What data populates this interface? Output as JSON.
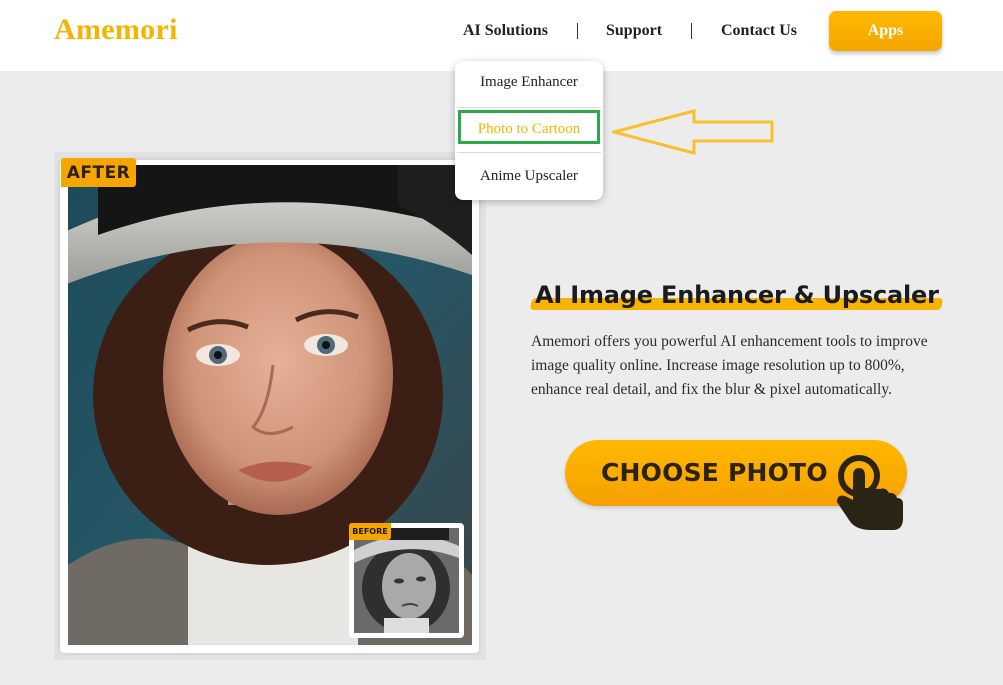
{
  "brand": {
    "name": "Amemori",
    "color": "#f4b400"
  },
  "nav": {
    "items": [
      {
        "label": "AI Solutions"
      },
      {
        "label": "Support"
      },
      {
        "label": "Contact Us"
      }
    ],
    "apps_label": "Apps"
  },
  "dropdown": {
    "items": [
      {
        "label": "Image Enhancer"
      },
      {
        "label": "Photo to Cartoon",
        "highlighted": true
      },
      {
        "label": "Anime Upscaler"
      }
    ],
    "highlight_color": "#2aa84a",
    "arrow_color": "#f6c12c"
  },
  "showcase": {
    "after_label": "AFTER",
    "before_label": "BEFORE"
  },
  "hero": {
    "title": "AI Image Enhancer & Upscaler",
    "description": "Amemori offers you powerful AI enhancement tools to improve image quality online. Increase image resolution up to 800%, enhance real detail, and fix the blur & pixel automatically.",
    "cta_label": "CHOOSE PHOTO",
    "accent": "#f8b400"
  }
}
